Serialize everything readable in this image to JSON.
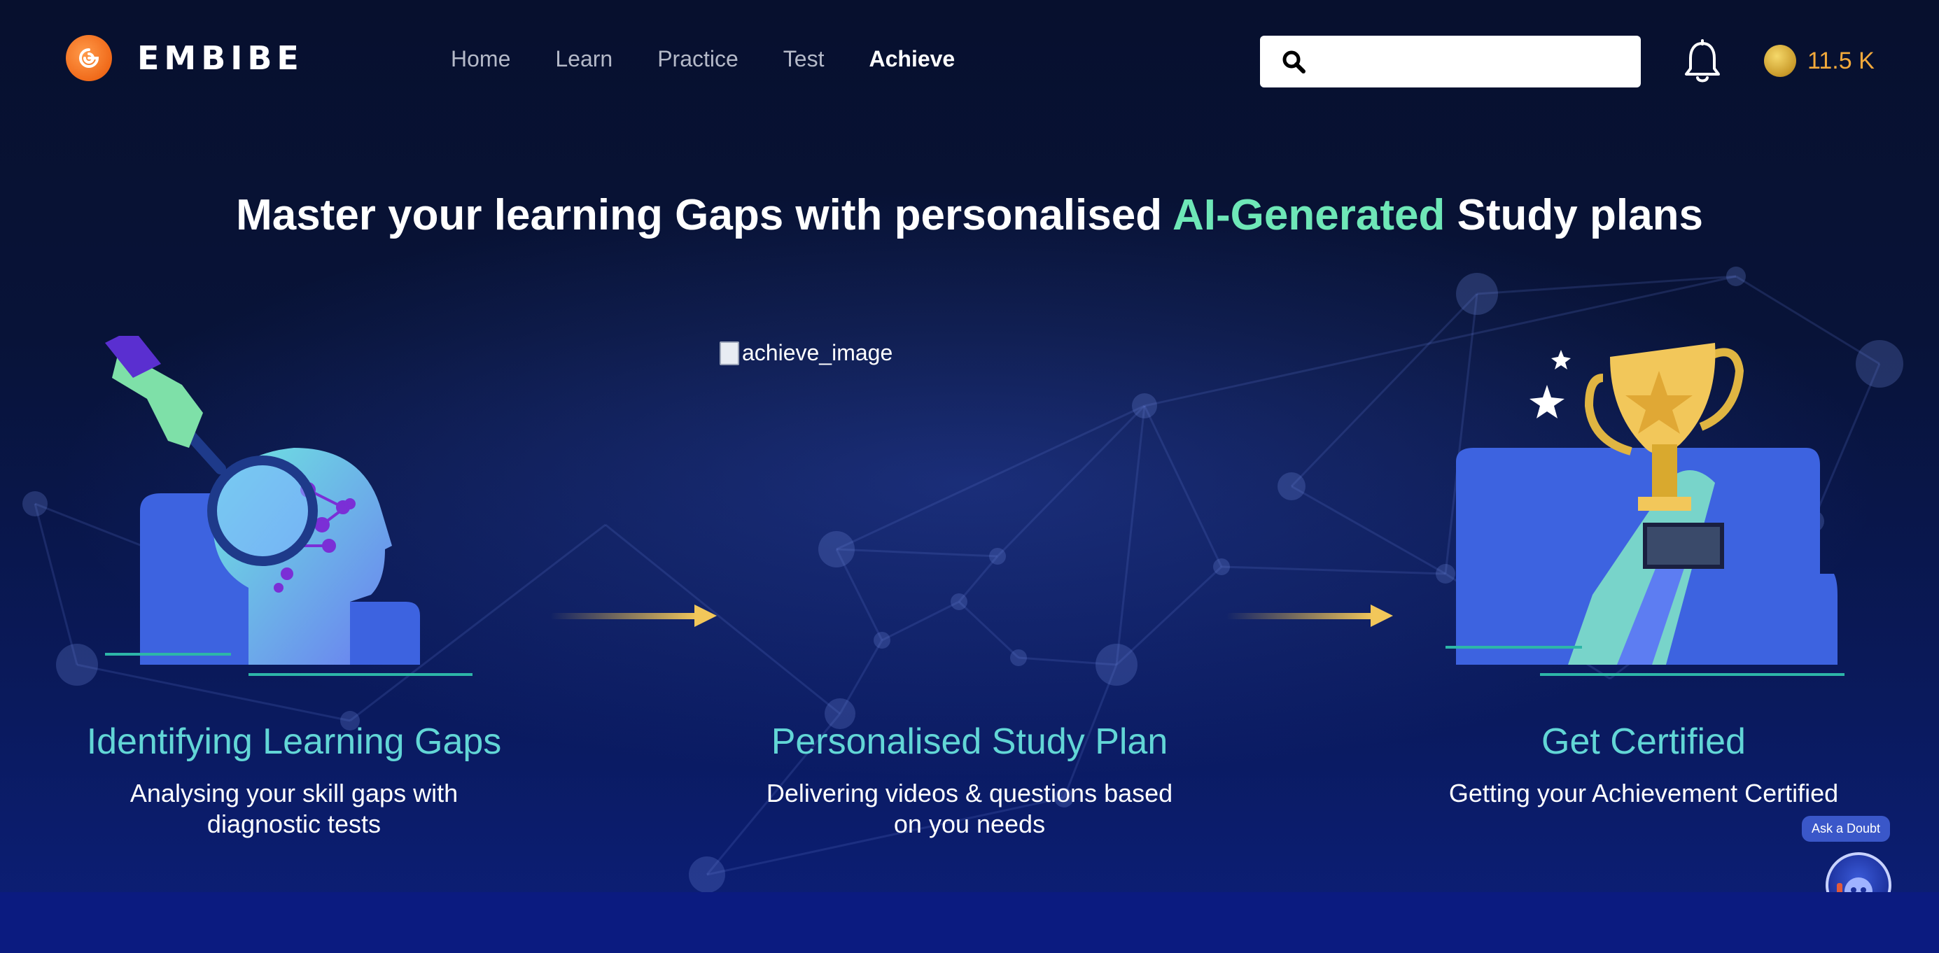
{
  "header": {
    "brand": "EMBIBE",
    "nav": [
      {
        "label": "Home",
        "active": false
      },
      {
        "label": "Learn",
        "active": false
      },
      {
        "label": "Practice",
        "active": false
      },
      {
        "label": "Test",
        "active": false
      },
      {
        "label": "Achieve",
        "active": true
      }
    ],
    "search": {
      "value": "",
      "placeholder": ""
    },
    "coins": "11.5 K"
  },
  "hero": {
    "headline_before": "Master your learning Gaps with personalised ",
    "headline_accent": "AI-Generated",
    "headline_after": " Study plans",
    "accent_color": "#6ee7b7"
  },
  "steps": [
    {
      "title": "Identifying Learning Gaps",
      "desc": "Analysing your skill gaps with diagnostic tests",
      "icon": "magnifier-brain-illustration"
    },
    {
      "title": "Personalised Study Plan",
      "desc": "Delivering videos & questions based on you needs",
      "image_alt": "achieve_image"
    },
    {
      "title": "Get Certified",
      "desc": "Getting your Achievement Certified",
      "icon": "trophy-illustration"
    }
  ],
  "doubt": {
    "label": "Ask a Doubt"
  },
  "colors": {
    "brand_orange": "#f06a1a",
    "step_title": "#62d6d6",
    "coin_text": "#f2a93b"
  }
}
